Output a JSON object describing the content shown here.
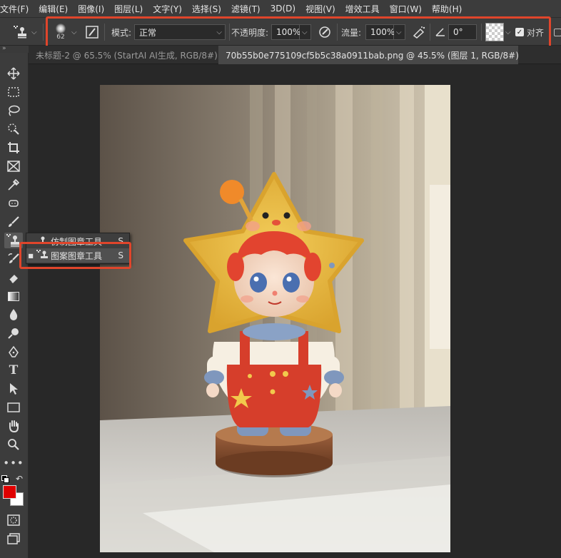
{
  "menu": [
    "文件(F)",
    "编辑(E)",
    "图像(I)",
    "图层(L)",
    "文字(Y)",
    "选择(S)",
    "滤镜(T)",
    "3D(D)",
    "视图(V)",
    "增效工具",
    "窗口(W)",
    "帮助(H)"
  ],
  "options": {
    "brush_size": "62",
    "mode_label": "模式:",
    "mode_value": "正常",
    "opacity_label": "不透明度:",
    "opacity_value": "100%",
    "flow_label": "流量:",
    "flow_value": "100%",
    "angle_value": "0°",
    "align_label": "对齐",
    "align_checked": true
  },
  "tabs": [
    {
      "label": "未标题-2 @ 65.5% (StartAI AI生成, RGB/8#) *",
      "close": "×"
    },
    {
      "label": "70b55b0e775109cf5b5c38a0911bab.png @ 45.5% (图层 1, RGB/8#) *",
      "close": "×"
    }
  ],
  "collapse_glyph": "»",
  "flyout": {
    "items": [
      {
        "label": "仿制图章工具",
        "shortcut": "S",
        "selected": false
      },
      {
        "label": "图案图章工具",
        "shortcut": "S",
        "selected": true
      }
    ]
  },
  "colors": {
    "foreground": "#e00000",
    "background": "#ffffff",
    "highlight": "#e0452b"
  },
  "icons": {
    "toolbar": [
      "move-icon",
      "marquee-icon",
      "lasso-icon",
      "quick-select-icon",
      "crop-icon",
      "frame-icon",
      "eyedropper-icon",
      "healing-icon",
      "brush-icon",
      "clone-stamp-icon",
      "history-brush-icon",
      "eraser-icon",
      "gradient-icon",
      "blur-icon",
      "dodge-icon",
      "pen-icon",
      "type-icon",
      "path-select-icon",
      "rectangle-icon",
      "hand-icon",
      "zoom-icon",
      "more-icon"
    ]
  }
}
